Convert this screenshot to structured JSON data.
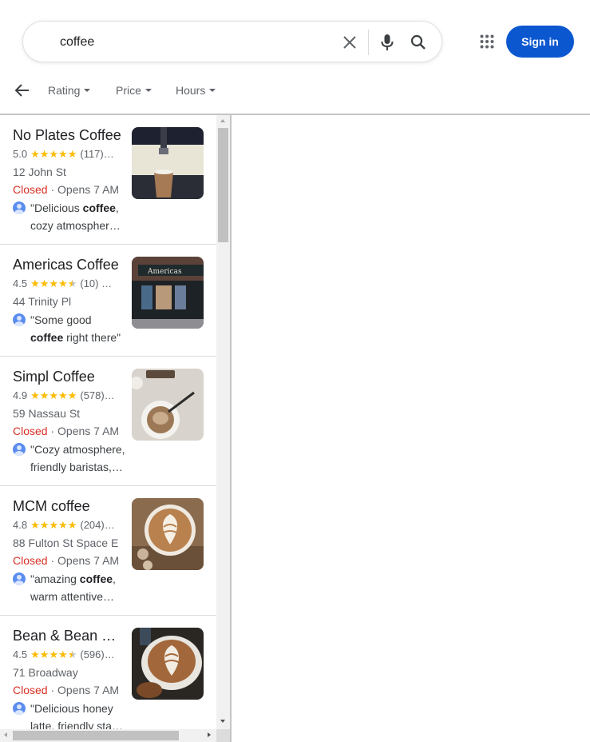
{
  "search": {
    "query": "coffee",
    "clear_icon": "close-icon",
    "mic_icon": "microphone-icon",
    "search_icon": "search-icon"
  },
  "header": {
    "apps_icon": "apps-grid-icon",
    "sign_in_label": "Sign in",
    "accent_color": "#0b57d0"
  },
  "filters": {
    "back_icon": "arrow-back-icon",
    "items": [
      {
        "label": "Rating"
      },
      {
        "label": "Price"
      },
      {
        "label": "Hours"
      }
    ]
  },
  "results": [
    {
      "name": "No Plates Coffee",
      "rating": "5.0",
      "stars": 5.0,
      "count": "(117)…",
      "address": "12 John St",
      "status": "Closed",
      "hours": " · Opens 7 AM",
      "review_a": "\"Delicious ",
      "review_bold": "coffee",
      "review_b": ",",
      "review_line2_a": "cozy atmospher…",
      "review_line2_bold": "",
      "review_line2_b": ""
    },
    {
      "name": "Americas Coffee",
      "rating": "4.5",
      "stars": 4.5,
      "count": "(10) …",
      "address": "44 Trinity Pl",
      "status": "",
      "hours": "",
      "review_a": "\"Some good",
      "review_bold": "",
      "review_b": "",
      "review_line2_a": "",
      "review_line2_bold": "coffee",
      "review_line2_b": " right there\""
    },
    {
      "name": "Simpl Coffee",
      "rating": "4.9",
      "stars": 5.0,
      "count": "(578)…",
      "address": "59 Nassau St",
      "status": "Closed",
      "hours": " · Opens 7 AM",
      "review_a": "\"Cozy atmosphere,",
      "review_bold": "",
      "review_b": "",
      "review_line2_a": "friendly baristas,…",
      "review_line2_bold": "",
      "review_line2_b": ""
    },
    {
      "name": "MCM coffee",
      "rating": "4.8",
      "stars": 5.0,
      "count": "(204)…",
      "address": "88 Fulton St Space E",
      "status": "Closed",
      "hours": " · Opens 7 AM",
      "review_a": "\"amazing ",
      "review_bold": "coffee",
      "review_b": ",",
      "review_line2_a": "warm attentive…",
      "review_line2_bold": "",
      "review_line2_b": ""
    },
    {
      "name": "Bean & Bean …",
      "rating": "4.5",
      "stars": 4.5,
      "count": "(596)…",
      "address": "71 Broadway",
      "status": "Closed",
      "hours": " · Opens 7 AM",
      "review_a": "\"Delicious honey",
      "review_bold": "",
      "review_b": "",
      "review_line2_a": "latte, friendly sta…",
      "review_line2_bold": "",
      "review_line2_b": ""
    }
  ],
  "status_color_closed": "#d93025",
  "star_color": "#fbbc04"
}
